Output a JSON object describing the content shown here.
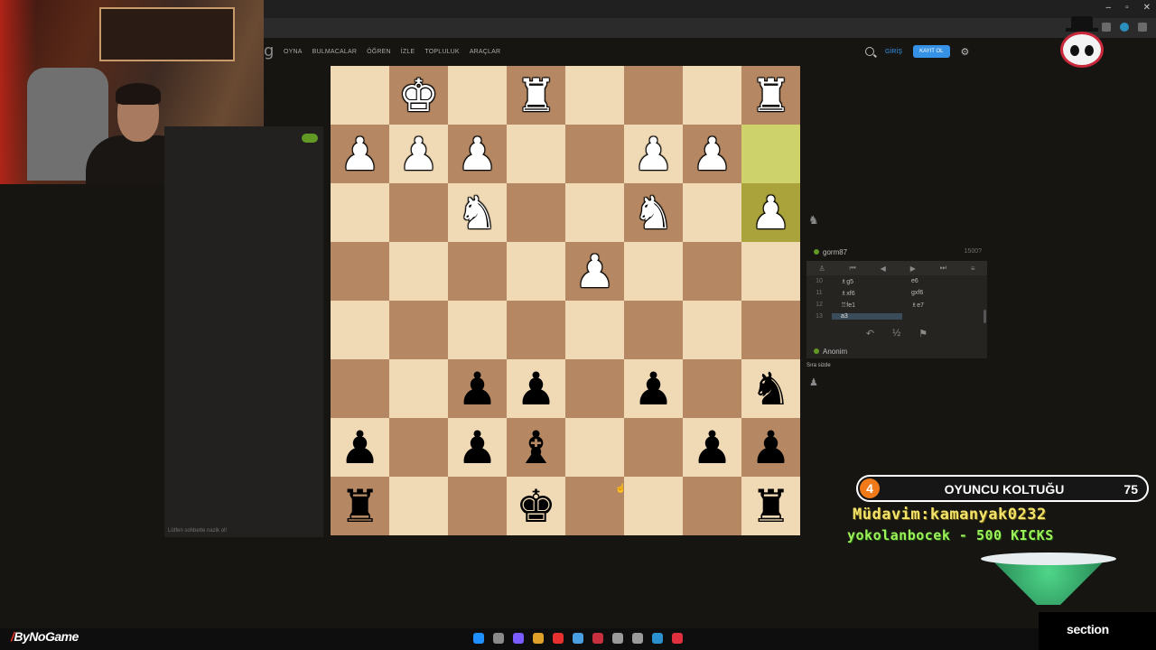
{
  "nav": {
    "logo_fragment": "g",
    "items": [
      "OYNA",
      "BULMACALAR",
      "ÖĞREN",
      "İZLE",
      "TOPLULUK",
      "ARAÇLAR"
    ],
    "login_label": "GİRİŞ",
    "signup_label": "KAYIT OL"
  },
  "window_controls": [
    "–",
    "▫",
    "✕"
  ],
  "chat": {
    "hint": "Lütfen sohbette nazik ol!"
  },
  "board": {
    "orientation": "black-bottom",
    "highlight_color_light": "#cdd26a",
    "highlight_color_dark": "#aaa23a",
    "ranks": [
      [
        {
          "p": "",
          "c": ""
        },
        {
          "p": "♚",
          "c": "w"
        },
        {
          "p": "",
          "c": ""
        },
        {
          "p": "♜",
          "c": "w"
        },
        {
          "p": "",
          "c": ""
        },
        {
          "p": "",
          "c": ""
        },
        {
          "p": "",
          "c": ""
        },
        {
          "p": "♜",
          "c": "w"
        }
      ],
      [
        {
          "p": "♟",
          "c": "w"
        },
        {
          "p": "♟",
          "c": "w"
        },
        {
          "p": "♟",
          "c": "w"
        },
        {
          "p": "",
          "c": ""
        },
        {
          "p": "",
          "c": ""
        },
        {
          "p": "♟",
          "c": "w"
        },
        {
          "p": "♟",
          "c": "w"
        },
        {
          "p": "",
          "c": "",
          "hl": true
        }
      ],
      [
        {
          "p": "",
          "c": ""
        },
        {
          "p": "",
          "c": ""
        },
        {
          "p": "♞",
          "c": "w"
        },
        {
          "p": "",
          "c": ""
        },
        {
          "p": "",
          "c": ""
        },
        {
          "p": "♞",
          "c": "w"
        },
        {
          "p": "",
          "c": ""
        },
        {
          "p": "♟",
          "c": "w",
          "hl": true
        }
      ],
      [
        {
          "p": "",
          "c": ""
        },
        {
          "p": "",
          "c": ""
        },
        {
          "p": "",
          "c": ""
        },
        {
          "p": "",
          "c": ""
        },
        {
          "p": "♟",
          "c": "w"
        },
        {
          "p": "",
          "c": ""
        },
        {
          "p": "",
          "c": ""
        },
        {
          "p": "",
          "c": ""
        }
      ],
      [
        {
          "p": "",
          "c": ""
        },
        {
          "p": "",
          "c": ""
        },
        {
          "p": "",
          "c": ""
        },
        {
          "p": "",
          "c": ""
        },
        {
          "p": "",
          "c": ""
        },
        {
          "p": "",
          "c": ""
        },
        {
          "p": "",
          "c": ""
        },
        {
          "p": "",
          "c": ""
        }
      ],
      [
        {
          "p": "",
          "c": ""
        },
        {
          "p": "",
          "c": ""
        },
        {
          "p": "♟",
          "c": "b"
        },
        {
          "p": "♟",
          "c": "b"
        },
        {
          "p": "",
          "c": ""
        },
        {
          "p": "♟",
          "c": "b"
        },
        {
          "p": "",
          "c": ""
        },
        {
          "p": "♞",
          "c": "b"
        }
      ],
      [
        {
          "p": "♟",
          "c": "b"
        },
        {
          "p": "",
          "c": ""
        },
        {
          "p": "♟",
          "c": "b"
        },
        {
          "p": "♝",
          "c": "b"
        },
        {
          "p": "",
          "c": ""
        },
        {
          "p": "",
          "c": ""
        },
        {
          "p": "♟",
          "c": "b"
        },
        {
          "p": "♟",
          "c": "b"
        }
      ],
      [
        {
          "p": "♜",
          "c": "b"
        },
        {
          "p": "",
          "c": ""
        },
        {
          "p": "",
          "c": ""
        },
        {
          "p": "♚",
          "c": "b"
        },
        {
          "p": "",
          "c": ""
        },
        {
          "p": "",
          "c": ""
        },
        {
          "p": "",
          "c": ""
        },
        {
          "p": "♜",
          "c": "b"
        }
      ]
    ]
  },
  "players": {
    "top_name": "gorm87",
    "top_rating": "1500?",
    "bottom_name": "Anonim",
    "turn_text": "Sıra sizde"
  },
  "move_ctrls": [
    "♙",
    "⏮",
    "◀",
    "▶",
    "⏭",
    "≡"
  ],
  "moves": [
    {
      "num": "10",
      "w": "♗g5",
      "b": "e6"
    },
    {
      "num": "11",
      "w": "♗xf6",
      "b": "gxf6"
    },
    {
      "num": "12",
      "w": "♖fe1",
      "b": "♗e7"
    },
    {
      "num": "13",
      "w": "a3",
      "b": ""
    }
  ],
  "game_ctrls": [
    "↶",
    "½",
    "⚑"
  ],
  "overlay": {
    "seat_number": "4",
    "seat_title": "OYUNCU KOLTUĞU",
    "seat_count": "75",
    "regular_line": "Müdavim:kamanyak0232",
    "lost_line": "yokolanbocek - 500 KICKS",
    "brand_left": "ByNoGame",
    "brand_right": "section",
    "brand_slash": "/"
  },
  "taskbar_icon_colors": [
    "#1e90ff",
    "#8a8a8a",
    "#7b5cff",
    "#e0a12a",
    "#e83030",
    "#4a9fe0",
    "#c83040",
    "#9a9a9a",
    "#9a9a9a",
    "#2a90d0",
    "#e03040"
  ]
}
